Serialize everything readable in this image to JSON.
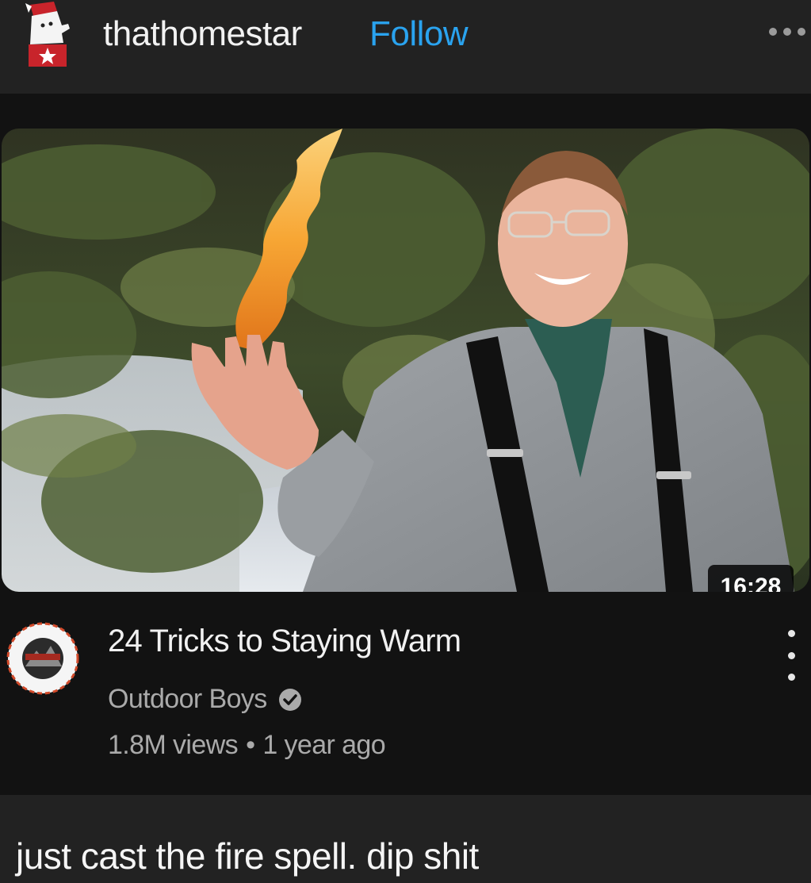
{
  "post": {
    "username": "thathomestar",
    "follow_label": "Follow",
    "avatar_icon": "homestar-avatar-icon",
    "more_icon": "more-horizontal-icon",
    "caption": "just cast the fire spell. dip shit"
  },
  "video": {
    "duration": "16:28",
    "title": "24 Tricks to Staying Warm",
    "channel": "Outdoor Boys",
    "channel_logo_icon": "outdoor-boys-logo",
    "verified_icon": "verified-check-icon",
    "views": "1.8M views",
    "separator": "•",
    "age": "1 year ago",
    "menu_icon": "more-vertical-icon"
  },
  "colors": {
    "background": "#222222",
    "card": "#121212",
    "accent_follow": "#2aa3ef",
    "text_primary": "#f1f1f1",
    "text_secondary": "#aaaaaa"
  }
}
